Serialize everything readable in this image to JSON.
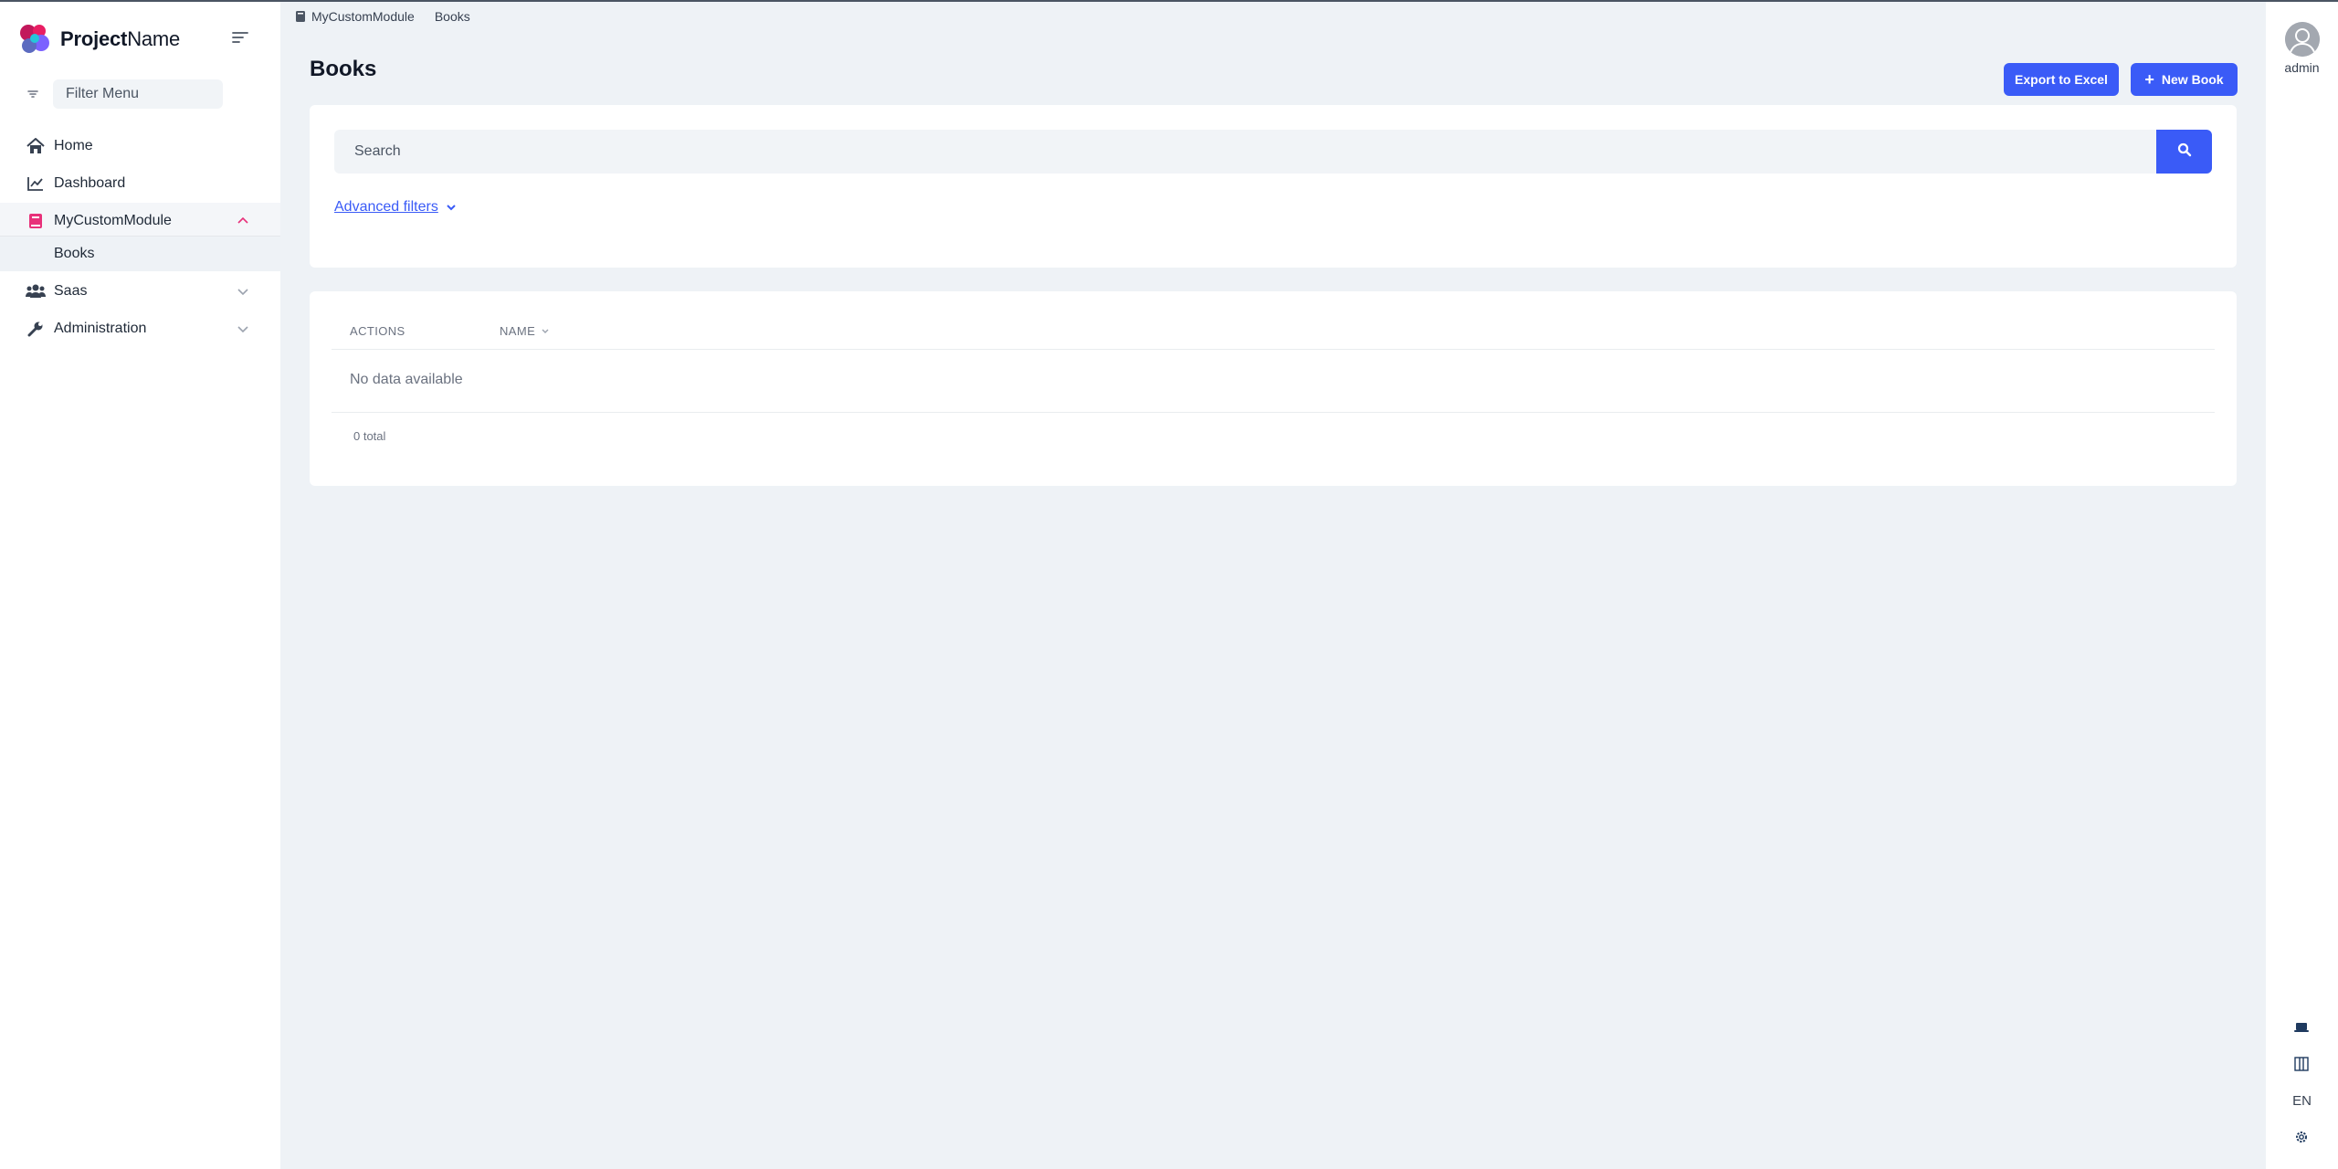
{
  "brand": {
    "bold": "Project",
    "light": "Name"
  },
  "sidebar": {
    "filter_placeholder": "Filter Menu",
    "items": [
      {
        "label": "Home",
        "icon": "home-icon"
      },
      {
        "label": "Dashboard",
        "icon": "chart-line-icon"
      },
      {
        "label": "MyCustomModule",
        "icon": "book-icon",
        "expanded": true
      },
      {
        "label": "Saas",
        "icon": "users-icon"
      },
      {
        "label": "Administration",
        "icon": "wrench-icon"
      }
    ],
    "subitems": [
      {
        "label": "Books"
      }
    ]
  },
  "breadcrumb": {
    "items": [
      "MyCustomModule",
      "Books"
    ]
  },
  "page": {
    "title": "Books"
  },
  "toolbar": {
    "export_label": "Export to Excel",
    "new_label": "New Book"
  },
  "search": {
    "placeholder": "Search",
    "advanced_label": "Advanced filters"
  },
  "table": {
    "headers": [
      "ACTIONS",
      "NAME"
    ],
    "empty_message": "No data available",
    "total_text": "0 total"
  },
  "user": {
    "name": "admin"
  },
  "rail": {
    "language": "EN"
  },
  "colors": {
    "primary": "#3a5bf7",
    "background": "#eef2f6",
    "accent_active": "#e8317a"
  }
}
